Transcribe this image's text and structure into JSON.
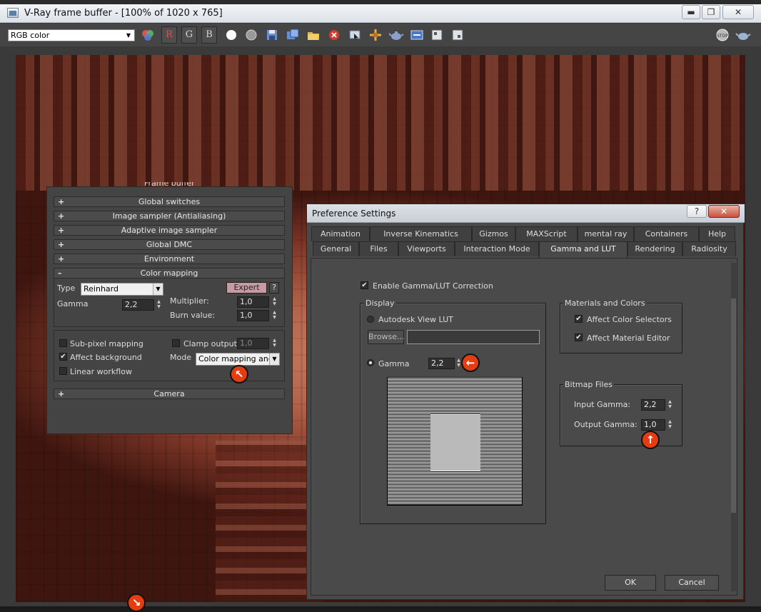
{
  "vfb": {
    "title": "V-Ray frame buffer - [100% of 1020 x 765]",
    "window_buttons": {
      "minimize": "▬",
      "restore": "❐",
      "close": "✕"
    },
    "channel": "RGB color",
    "channel_buttons": {
      "r": "R",
      "g": "G",
      "b": "B"
    },
    "colors": {
      "red": "#e05050",
      "green": "#d6d6d6",
      "blue": "#d6d6d6",
      "render_tint": "#b06048"
    }
  },
  "render_setup": {
    "header_fragment": "Frame buffer",
    "rollouts": [
      {
        "sign": "+",
        "label": "Global switches"
      },
      {
        "sign": "+",
        "label": "Image sampler (Antialiasing)"
      },
      {
        "sign": "+",
        "label": "Adaptive image sampler"
      },
      {
        "sign": "+",
        "label": "Global DMC"
      },
      {
        "sign": "+",
        "label": "Environment"
      },
      {
        "sign": "–",
        "label": "Color mapping"
      }
    ],
    "color_mapping": {
      "type_label": "Type",
      "type_value": "Reinhard",
      "expert_label": "Expert",
      "help_label": "?",
      "gamma_label": "Gamma",
      "gamma_value": "2,2",
      "multiplier_label": "Multiplier:",
      "multiplier_value": "1,0",
      "burn_label": "Burn value:",
      "burn_value": "1,0",
      "subpixel_label": "Sub-pixel mapping",
      "clamp_label": "Clamp output",
      "clamp_value": "1,0",
      "affect_bg_label": "Affect background",
      "mode_label": "Mode",
      "mode_value": "Color mapping and g",
      "linear_label": "Linear workflow"
    },
    "camera": {
      "sign": "+",
      "label": "Camera"
    }
  },
  "markers": {
    "up_left": "↖",
    "left": "←",
    "up": "↑",
    "down_right": "↘"
  },
  "preferences": {
    "title": "Preference Settings",
    "help_btn": "?",
    "close_btn": "✕",
    "tabs_row1": [
      "Animation",
      "Inverse Kinematics",
      "Gizmos",
      "MAXScript",
      "mental ray",
      "Containers",
      "Help"
    ],
    "tabs_row2": [
      "General",
      "Files",
      "Viewports",
      "Interaction Mode",
      "Gamma and LUT",
      "Rendering",
      "Radiosity"
    ],
    "active_tab": "Gamma and LUT",
    "enable_label": "Enable Gamma/LUT Correction",
    "display_group": "Display",
    "autodesk_lut_label": "Autodesk View LUT",
    "browse_label": "Browse...",
    "browse_path": "",
    "gamma_label": "Gamma",
    "gamma_value": "2,2",
    "materials_group": "Materials and Colors",
    "affect_color_label": "Affect Color Selectors",
    "affect_material_label": "Affect Material Editor",
    "bitmap_group": "Bitmap Files",
    "input_gamma_label": "Input Gamma:",
    "input_gamma_value": "2,2",
    "output_gamma_label": "Output Gamma:",
    "output_gamma_value": "1,0",
    "ok_label": "OK",
    "cancel_label": "Cancel"
  }
}
